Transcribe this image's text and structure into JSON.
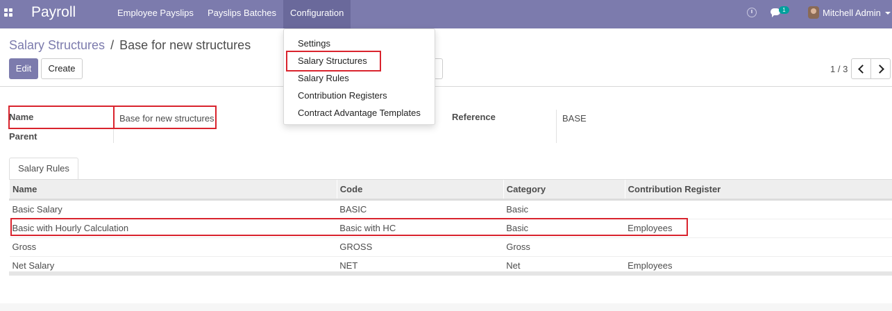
{
  "navbar": {
    "app_name": "Payroll",
    "menus": [
      "Employee Payslips",
      "Payslips Batches",
      "Configuration"
    ],
    "notification_count": "1",
    "user_name": "Mitchell Admin",
    "accent_color": "#7c7bad"
  },
  "dropdown": {
    "items": [
      "Settings",
      "Salary Structures",
      "Salary Rules",
      "Contribution Registers",
      "Contract Advantage Templates"
    ]
  },
  "breadcrumb": {
    "parent": "Salary Structures",
    "separator": "/",
    "current": "Base for new structures"
  },
  "toolbar": {
    "edit_label": "Edit",
    "create_label": "Create",
    "pager": "1 / 3"
  },
  "form": {
    "name_label": "Name",
    "name_value": "Base for new structures",
    "parent_label": "Parent",
    "parent_value": "",
    "reference_label": "Reference",
    "reference_value": "BASE"
  },
  "tabs": {
    "salary_rules": "Salary Rules"
  },
  "table": {
    "headers": [
      "Name",
      "Code",
      "Category",
      "Contribution Register"
    ],
    "rows": [
      [
        "Basic Salary",
        "BASIC",
        "Basic",
        ""
      ],
      [
        "Basic with Hourly Calculation",
        "Basic with HC",
        "Basic",
        "Employees"
      ],
      [
        "Gross",
        "GROSS",
        "Gross",
        ""
      ],
      [
        "Net Salary",
        "NET",
        "Net",
        "Employees"
      ]
    ]
  },
  "icons": {
    "apps": "apps-grid-icon",
    "clock": "clock-icon",
    "chat": "chat-icon",
    "prev": "chevron-left-icon",
    "next": "chevron-right-icon"
  },
  "highlight_color": "#d9232d"
}
